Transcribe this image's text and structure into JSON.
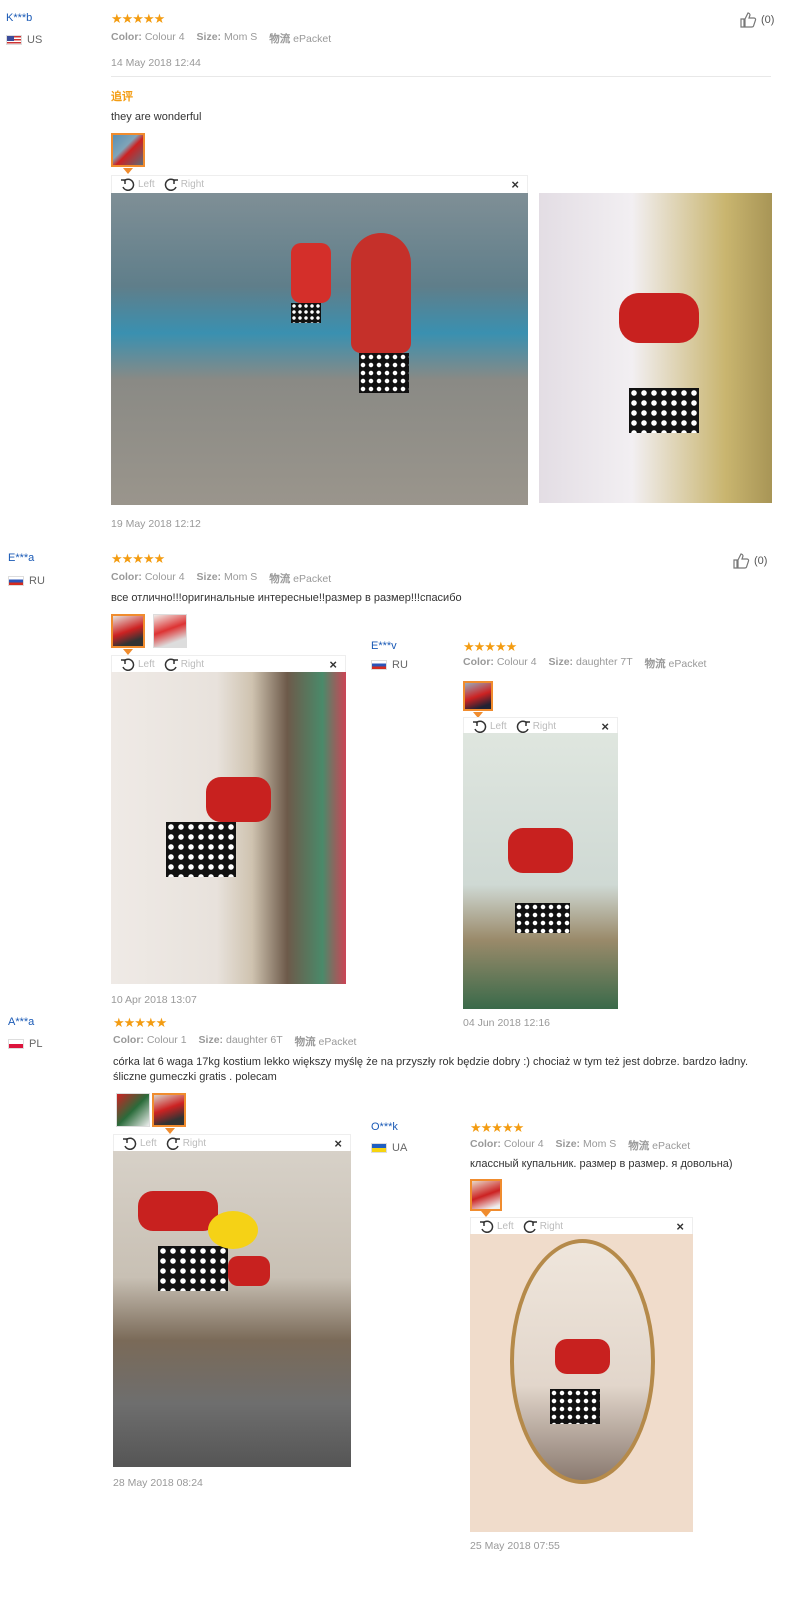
{
  "reviews": [
    {
      "user": "K***b",
      "country": "US",
      "stars": "★★★★★",
      "color_label": "Color:",
      "color_value": "Colour 4",
      "size_label": "Size:",
      "size_value": "Mom S",
      "ship_label": "物流",
      "ship_value": "ePacket",
      "date": "14 May 2018 12:44",
      "helpful": "(0)",
      "append_label": "追评",
      "append_text": "they are wonderful",
      "append_date": "19 May 2018 12:12"
    },
    {
      "user": "E***a",
      "country": "RU",
      "stars": "★★★★★",
      "color_label": "Color:",
      "color_value": "Colour 4",
      "size_label": "Size:",
      "size_value": "Mom S",
      "ship_label": "物流",
      "ship_value": "ePacket",
      "helpful": "(0)",
      "text": "все отлично!!!оригинальные интересные!!размер в размер!!!спасибо",
      "date": "10 Apr 2018 13:07"
    },
    {
      "user": "E***v",
      "country": "RU",
      "stars": "★★★★★",
      "color_label": "Color:",
      "color_value": "Colour 4",
      "size_label": "Size:",
      "size_value": "daughter 7T",
      "ship_label": "物流",
      "ship_value": "ePacket",
      "date": "04 Jun 2018 12:16"
    },
    {
      "user": "A***a",
      "country": "PL",
      "stars": "★★★★★",
      "color_label": "Color:",
      "color_value": "Colour 1",
      "size_label": "Size:",
      "size_value": "daughter 6T",
      "ship_label": "物流",
      "ship_value": "ePacket",
      "text": "córka lat 6 waga 17kg kostium lekko większy myślę że na przyszły rok będzie dobry :) chociaż w tym też jest dobrze. bardzo ładny. śliczne gumeczki gratis . polecam",
      "date": "28 May 2018 08:24"
    },
    {
      "user": "O***k",
      "country": "UA",
      "stars": "★★★★★",
      "color_label": "Color:",
      "color_value": "Colour 4",
      "size_label": "Size:",
      "size_value": "Mom S",
      "ship_label": "物流",
      "ship_value": "ePacket",
      "text": "классный купальник. размер в размер. я довольна)",
      "date": "25 May 2018 07:55"
    }
  ],
  "viewer": {
    "left_label": "Left",
    "right_label": "Right",
    "close_glyph": "×"
  },
  "colors": {
    "star": "#f39c12",
    "username": "#1a5ab6",
    "active_thumb": "#f08c2e"
  }
}
